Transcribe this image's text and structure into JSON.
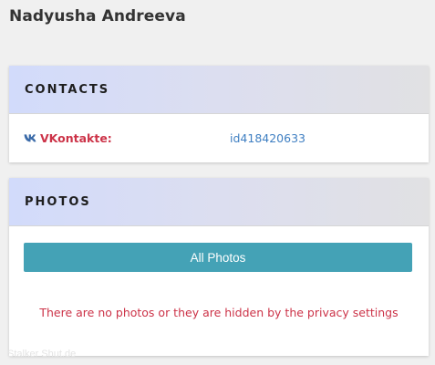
{
  "profile": {
    "name": "Nadyusha Andreeva"
  },
  "contacts": {
    "title": "CONTACTS",
    "items": [
      {
        "network_icon": "vk-icon",
        "label": "VKontakte:",
        "value": "id418420633",
        "label_color": "#cc3348",
        "value_color": "#3f7fc2"
      }
    ]
  },
  "photos": {
    "title": "PHOTOS",
    "button_label": "All Photos",
    "button_color": "#44a2b6",
    "empty_message": "There are no photos or they are hidden by the privacy settings",
    "empty_message_color": "#cc3348"
  },
  "watermark": {
    "text": "Stalker Shut.de"
  }
}
